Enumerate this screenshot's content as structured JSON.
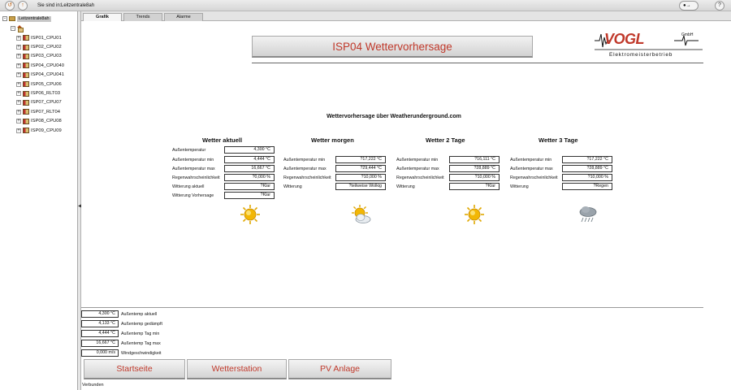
{
  "topbar": {
    "location_label": "Sie sind in:",
    "location_value": "Leitzentrale8ah",
    "left_icons": [
      "back-icon",
      "up-icon"
    ],
    "right_icons": [
      "tools-icon",
      "help-icon"
    ]
  },
  "sidebar": {
    "root_label": "Leitzentrale8ah",
    "items": [
      {
        "label": "ISP01_CPU01"
      },
      {
        "label": "ISP02_CPU02"
      },
      {
        "label": "ISP03_CPU03"
      },
      {
        "label": "ISP04_CPU040"
      },
      {
        "label": "ISP04_CPU041"
      },
      {
        "label": "ISP05_CPU06"
      },
      {
        "label": "ISP06_RLT03"
      },
      {
        "label": "ISP07_CPU07"
      },
      {
        "label": "ISP07_RLT04"
      },
      {
        "label": "ISP08_CPU08"
      },
      {
        "label": "ISP09_CPU09"
      }
    ]
  },
  "tabs": [
    {
      "label": "Grafik",
      "active": true
    },
    {
      "label": "Trends",
      "active": false
    },
    {
      "label": "Alarme",
      "active": false
    }
  ],
  "header": {
    "title": "ISP04 Wettervorhersage",
    "logo_text": "VOGL",
    "logo_gmbh": "GmbH",
    "logo_sub": "Elektromeisterbetrieb"
  },
  "subtitle": "Wettervorhersage über Weatherunderground.com",
  "columns": [
    {
      "title": "Wetter aktuell",
      "icon": "sun-icon",
      "rows": [
        {
          "label": "Außentemperatur",
          "value": "4,300 °C"
        },
        {
          "label": "Außentemperatur min",
          "value": "4,444 °C"
        },
        {
          "label": "Außentemperatur max",
          "value": "16,667 °C"
        },
        {
          "label": "Regenwahrscheinlichkeit",
          "value": "?0,000 %"
        },
        {
          "label": "Witterung aktuell",
          "value": "?Klar"
        },
        {
          "label": "Witterung Vorhersage",
          "value": "?Klar"
        }
      ]
    },
    {
      "title": "Wetter morgen",
      "icon": "partly-cloudy-icon",
      "rows": [
        {
          "label": "Außentemperatur min",
          "value": "?17,222 °C"
        },
        {
          "label": "Außentemperatur max",
          "value": "?29,444 °C"
        },
        {
          "label": "Regenwahrscheinlichkeit",
          "value": "?10,000 %"
        },
        {
          "label": "Witterung",
          "value": "?teilweise Wolkig"
        }
      ]
    },
    {
      "title": "Wetter 2 Tage",
      "icon": "sun-icon",
      "rows": [
        {
          "label": "Außentemperatur min",
          "value": "?16,111 °C"
        },
        {
          "label": "Außentemperatur max",
          "value": "?28,889 °C"
        },
        {
          "label": "Regenwahrscheinlichkeit",
          "value": "?10,000 %"
        },
        {
          "label": "Witterung",
          "value": "?Klar"
        }
      ]
    },
    {
      "title": "Wetter 3 Tage",
      "icon": "rain-cloud-icon",
      "rows": [
        {
          "label": "Außentemperatur min",
          "value": "?17,222 °C"
        },
        {
          "label": "Außentemperatur max",
          "value": "?28,889 °C"
        },
        {
          "label": "Regenwahrscheinlichkeit",
          "value": "?10,000 %"
        },
        {
          "label": "Witterung",
          "value": "?Regen"
        }
      ]
    }
  ],
  "station": [
    {
      "value": "4,300 °C",
      "label": "Außentemp aktuell"
    },
    {
      "value": "4,133 °C",
      "label": "Außentemp gedämpft"
    },
    {
      "value": "4,444 °C",
      "label": "Außentemp Tag min"
    },
    {
      "value": "16,667 °C",
      "label": "Außentemp Tag max"
    },
    {
      "value": "0,000 m/s",
      "label": "Windgeschwindigkeit"
    }
  ],
  "nav": {
    "start": "Startseite",
    "station": "Wetterstation",
    "pv": "PV Anlage"
  },
  "status": "Verbunden",
  "colors": {
    "accent": "#c0392b",
    "sun": "#f2b705",
    "folder": "#c9a04a"
  }
}
